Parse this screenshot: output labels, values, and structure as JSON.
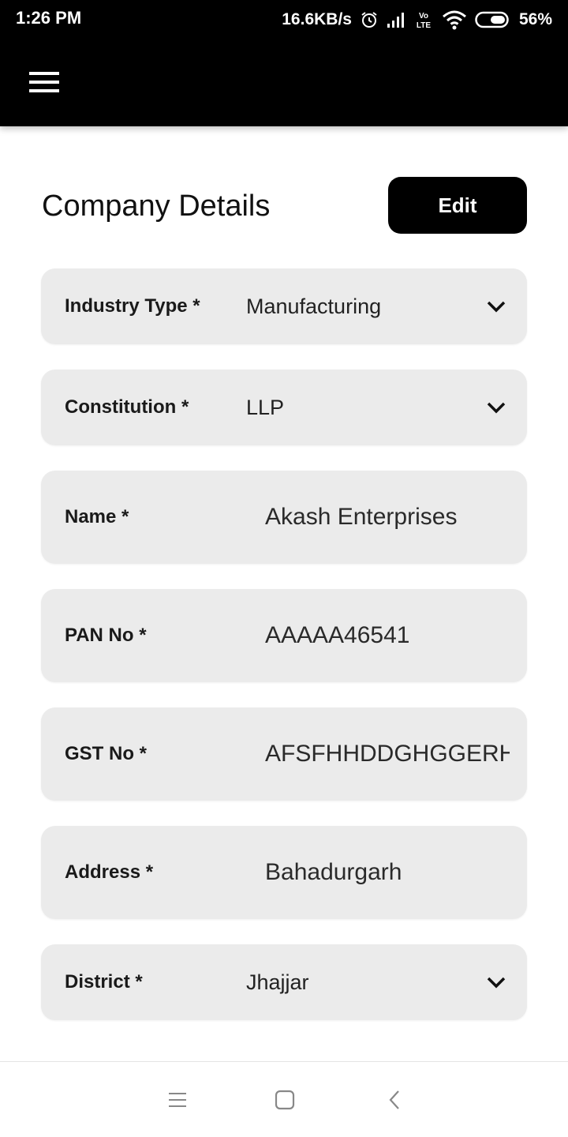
{
  "status_bar": {
    "time": "1:26 PM",
    "speed": "16.6KB/s",
    "battery": "56%",
    "icons": [
      "alarm-icon",
      "signal-icon",
      "volte-icon",
      "wifi-icon",
      "battery-icon"
    ]
  },
  "app_bar": {
    "menu_icon": "hamburger-menu-icon"
  },
  "page": {
    "title": "Company Details",
    "edit_label": "Edit"
  },
  "form": {
    "industry_type": {
      "label": "Industry Type *",
      "value": "Manufacturing"
    },
    "constitution": {
      "label": "Constitution *",
      "value": "LLP"
    },
    "name": {
      "label": "Name *",
      "value": "Akash Enterprises"
    },
    "pan_no": {
      "label": "PAN No *",
      "value": "AAAAA46541"
    },
    "gst_no": {
      "label": "GST No *",
      "value": "AFSFHHDDGHGGERH"
    },
    "address": {
      "label": "Address *",
      "value": "Bahadurgarh"
    },
    "district": {
      "label": "District *",
      "value": "Jhajjar"
    }
  },
  "nav_bar": {
    "icons": [
      "recent-apps-icon",
      "home-icon",
      "back-icon"
    ]
  },
  "colors": {
    "app_bar": "#000000",
    "field_background": "#ebebeb",
    "button_background": "#000000",
    "button_text": "#ffffff"
  }
}
